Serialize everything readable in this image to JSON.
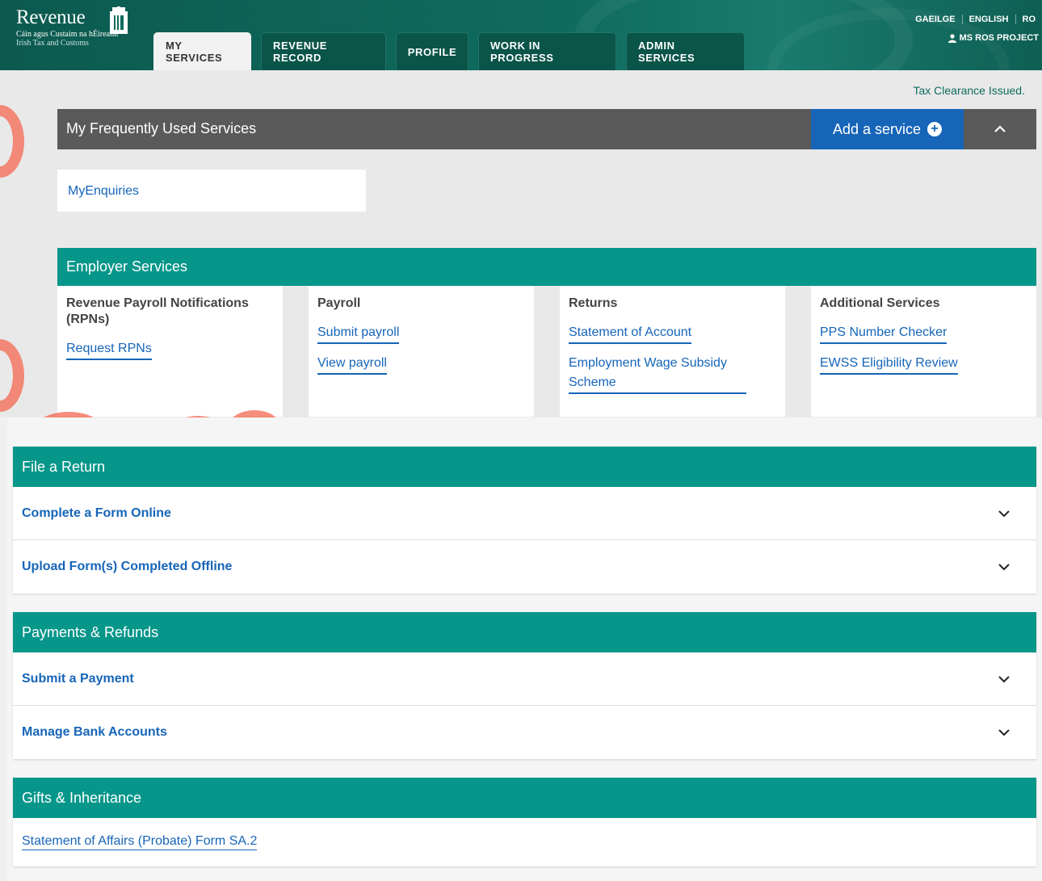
{
  "header": {
    "logo_name": "Revenue",
    "logo_sub1": "Cáin agus Custaim na hÉireann",
    "logo_sub2": "Irish Tax and Customs",
    "tabs": [
      {
        "label": "MY SERVICES",
        "active": true
      },
      {
        "label": "REVENUE RECORD",
        "active": false
      },
      {
        "label": "PROFILE",
        "active": false
      },
      {
        "label": "WORK IN PROGRESS",
        "active": false
      },
      {
        "label": "ADMIN SERVICES",
        "active": false
      }
    ],
    "languages": [
      "GAEILGE",
      "ENGLISH",
      "RO"
    ],
    "user_name": "MS ROS PROJECT"
  },
  "status_link": "Tax Clearance Issued.",
  "favourites": {
    "title": "My Frequently Used Services",
    "add_label": "Add a service",
    "items": [
      "MyEnquiries"
    ]
  },
  "employer": {
    "title": "Employer Services",
    "columns": [
      {
        "heading": "Revenue Payroll Notifications (RPNs)",
        "links": [
          "Request RPNs"
        ]
      },
      {
        "heading": "Payroll",
        "links": [
          "Submit payroll",
          "View payroll"
        ]
      },
      {
        "heading": "Returns",
        "links": [
          "Statement of Account",
          "Employment Wage Subsidy Scheme"
        ]
      },
      {
        "heading": "Additional Services",
        "links": [
          "PPS Number Checker",
          "EWSS Eligibility Review"
        ]
      }
    ]
  },
  "file_return": {
    "title": "File a Return",
    "rows": [
      "Complete a Form Online",
      "Upload Form(s) Completed Offline"
    ]
  },
  "payments": {
    "title": "Payments & Refunds",
    "rows": [
      "Submit a Payment",
      "Manage Bank Accounts"
    ]
  },
  "gifts": {
    "title": "Gifts & Inheritance",
    "link": "Statement of Affairs (Probate) Form SA.2"
  },
  "icons": {
    "harp": "harp-logo-icon",
    "user": "user-icon",
    "plus": "plus-circle-icon",
    "collapse": "chevron-up-icon",
    "expand": "chevron-down-icon"
  },
  "colors": {
    "header_green": "#0f6b5e",
    "teal": "#06968a",
    "link_blue": "#1665b8",
    "dark_grey": "#5a5a5a"
  }
}
